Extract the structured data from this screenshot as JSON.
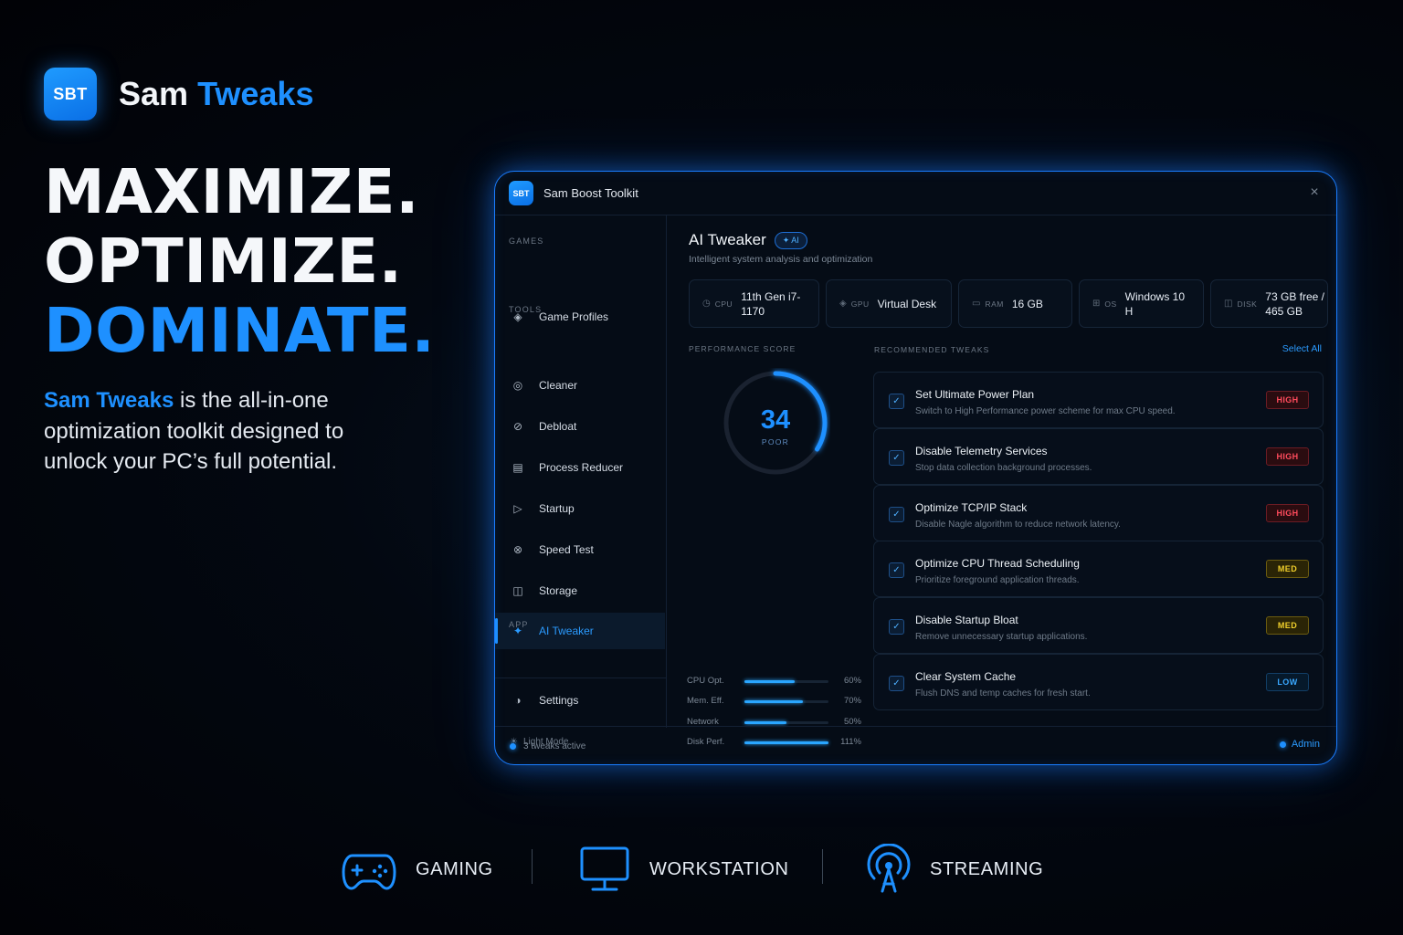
{
  "brand": {
    "logo_text": "SBT",
    "name_part1": "Sam",
    "name_part2": "Tweaks"
  },
  "hero": {
    "line1": "MAXIMIZE.",
    "line2": "OPTIMIZE.",
    "line3": "DOMINATE."
  },
  "tagline": {
    "highlight": "Sam Tweaks",
    "rest": " is the all-in-one optimization toolkit designed to unlock your PC’s full potential."
  },
  "window": {
    "logo_text": "SBT",
    "title": "Sam Boost Toolkit",
    "close_icon": "×"
  },
  "sidebar": {
    "sections": {
      "games": "GAMES",
      "tools": "TOOLS",
      "app": "APP"
    },
    "items": [
      {
        "label": "Game Profiles",
        "icon": "◈",
        "icon_name": "diamond-icon"
      },
      {
        "label": "Cleaner",
        "icon": "◎",
        "icon_name": "target-icon"
      },
      {
        "label": "Debloat",
        "icon": "⊘",
        "icon_name": "slash-circle-icon"
      },
      {
        "label": "Process Reducer",
        "icon": "▤",
        "icon_name": "list-icon"
      },
      {
        "label": "Startup",
        "icon": "▷",
        "icon_name": "play-icon"
      },
      {
        "label": "Speed Test",
        "icon": "⊗",
        "icon_name": "speed-icon"
      },
      {
        "label": "Storage",
        "icon": "◫",
        "icon_name": "storage-icon"
      },
      {
        "label": "AI Tweaker",
        "icon": "✦",
        "icon_name": "sparkle-icon"
      },
      {
        "label": "Settings",
        "icon": "◑",
        "icon_name": "half-circle-icon"
      }
    ],
    "active_item": "AI Tweaker",
    "light_mode": "Light Mode"
  },
  "footer": {
    "status": "3 tweaks active",
    "user": "Admin"
  },
  "main": {
    "title": "AI Tweaker",
    "badge": "✦ AI",
    "subtitle": "Intelligent system analysis and optimization",
    "specs": [
      {
        "label": "CPU",
        "value": "11th Gen i7-1170",
        "icon": "◷"
      },
      {
        "label": "GPU",
        "value": "Virtual Desk",
        "icon": "◈"
      },
      {
        "label": "RAM",
        "value": "16 GB",
        "icon": "▭"
      },
      {
        "label": "OS",
        "value": "Windows 10 H",
        "icon": "⊞"
      },
      {
        "label": "DISK",
        "value": "73 GB free / 465 GB",
        "icon": "◫"
      }
    ],
    "performance": {
      "title": "PERFORMANCE SCORE",
      "score": "34",
      "score_value": 34,
      "rating": "POOR",
      "metrics": [
        {
          "label": "CPU Opt.",
          "value": "60%",
          "fill": 0.6
        },
        {
          "label": "Mem. Eff.",
          "value": "70%",
          "fill": 0.7
        },
        {
          "label": "Network",
          "value": "50%",
          "fill": 0.5
        },
        {
          "label": "Disk Perf.",
          "value": "111%",
          "fill": 1.0
        }
      ]
    },
    "recommended": {
      "title": "RECOMMENDED TWEAKS",
      "select_all": "Select All",
      "tweaks": [
        {
          "title": "Set Ultimate Power Plan",
          "desc": "Switch to High Performance power scheme for max CPU speed.",
          "level": "HIGH",
          "checked": true
        },
        {
          "title": "Disable Telemetry Services",
          "desc": "Stop data collection background processes.",
          "level": "HIGH",
          "checked": true
        },
        {
          "title": "Optimize TCP/IP Stack",
          "desc": "Disable Nagle algorithm to reduce network latency.",
          "level": "HIGH",
          "checked": true
        },
        {
          "title": "Optimize CPU Thread Scheduling",
          "desc": "Prioritize foreground application threads.",
          "level": "MED",
          "checked": true
        },
        {
          "title": "Disable Startup Bloat",
          "desc": "Remove unnecessary startup applications.",
          "level": "MED",
          "checked": true
        },
        {
          "title": "Clear System Cache",
          "desc": "Flush DNS and temp caches for fresh start.",
          "level": "LOW",
          "checked": true
        }
      ]
    }
  },
  "features": [
    {
      "label": "GAMING",
      "icon_name": "gamepad-icon"
    },
    {
      "label": "WORKSTATION",
      "icon_name": "monitor-icon"
    },
    {
      "label": "STREAMING",
      "icon_name": "broadcast-icon"
    }
  ],
  "colors": {
    "accent": "#1e90ff",
    "high": "#ff4b5c",
    "med": "#f1d02b",
    "low": "#3aa8ff"
  }
}
